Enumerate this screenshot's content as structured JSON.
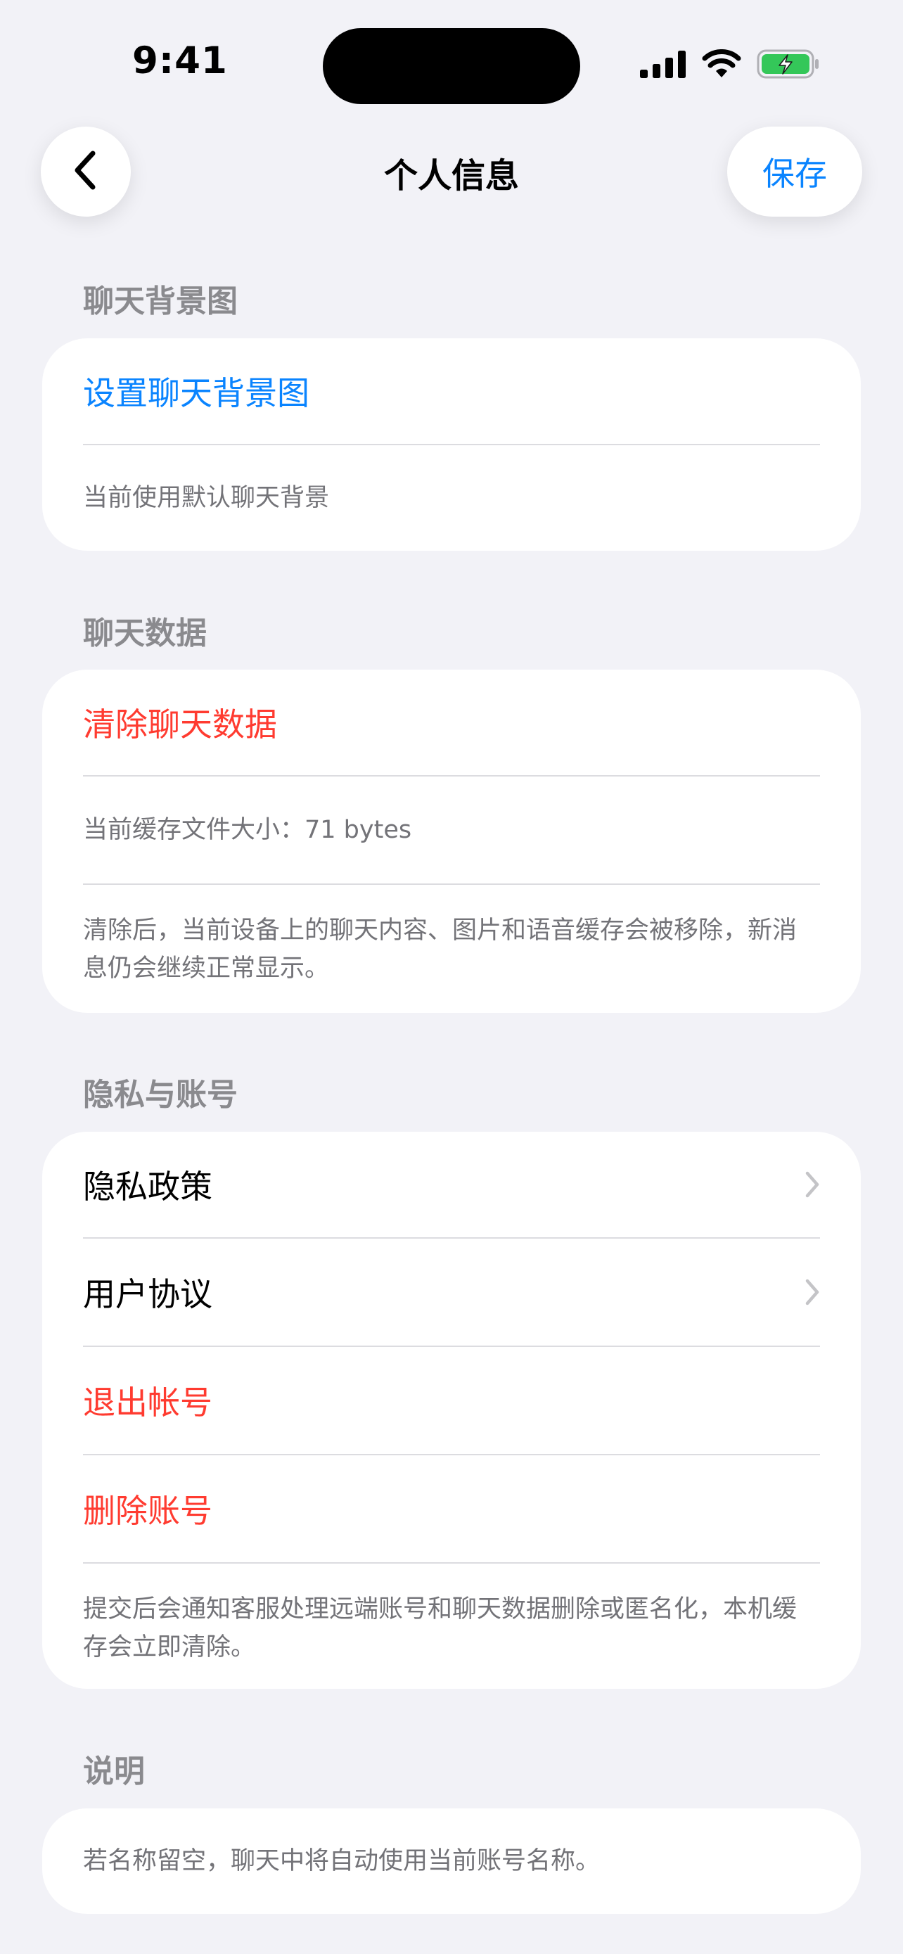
{
  "status_bar": {
    "time": "9:41"
  },
  "nav": {
    "title": "个人信息",
    "save_label": "保存"
  },
  "sections": {
    "background": {
      "header": "聊天背景图",
      "set_label": "设置聊天背景图",
      "current_note": "当前使用默认聊天背景"
    },
    "chat_data": {
      "header": "聊天数据",
      "clear_label": "清除聊天数据",
      "cache_size": "当前缓存文件大小：71 bytes",
      "clear_note": "清除后，当前设备上的聊天内容、图片和语音缓存会被移除，新消息仍会继续正常显示。"
    },
    "privacy": {
      "header": "隐私与账号",
      "privacy_policy": "隐私政策",
      "user_agreement": "用户协议",
      "logout": "退出帐号",
      "delete_account": "删除账号",
      "delete_note": "提交后会通知客服处理远端账号和聊天数据删除或匿名化，本机缓存会立即清除。"
    },
    "explanation": {
      "header": "说明",
      "note": "若名称留空，聊天中将自动使用当前账号名称。"
    }
  },
  "icons": {
    "signal": "cellular-signal-icon",
    "wifi": "wifi-icon",
    "battery": "battery-charging-icon",
    "back": "chevron-left-icon",
    "disclosure": "chevron-right-icon"
  },
  "colors": {
    "accent_blue": "#0a84ff",
    "destructive_red": "#ff3b30",
    "background": "#f2f2f7",
    "battery_green": "#34c759"
  }
}
